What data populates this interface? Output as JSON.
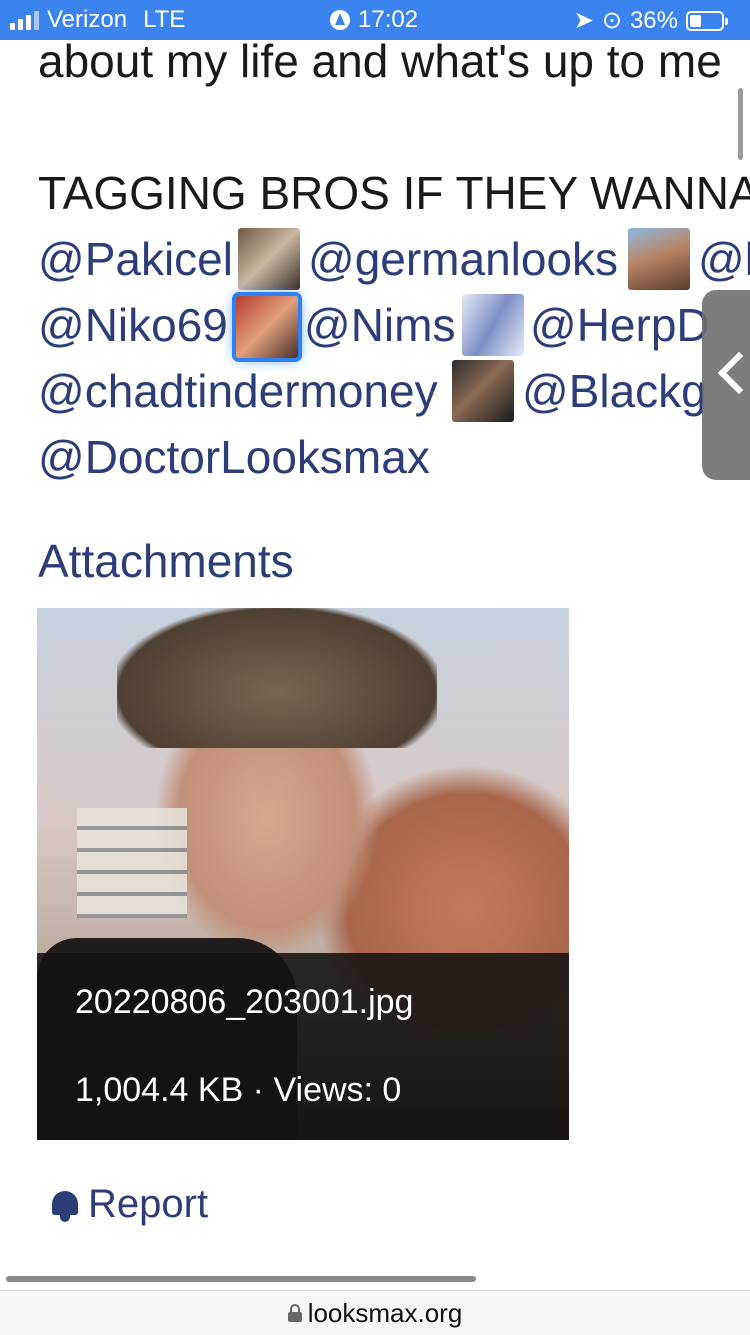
{
  "status_bar": {
    "carrier": "Verizon",
    "network": "LTE",
    "time": "17:02",
    "battery": "36%"
  },
  "post": {
    "line_top": "about my life and what's up to me",
    "line_tag": "TAGGING BROS IF THEY WANNA",
    "mentions": {
      "pakicel": "@Pakicel",
      "germanlooks": "@germanlooks",
      "b": "@b",
      "niko69": "@Niko69",
      "nims": "@Nims",
      "herpd": "@HerpD",
      "chadtindermoney": "@chadtindermoney",
      "blackg": "@Blackg",
      "doctorlooksmax": "@DoctorLooksmax"
    }
  },
  "attachments": {
    "heading": "Attachments",
    "file_name": "20220806_203001.jpg",
    "file_meta": "1,004.4 KB · Views: 0"
  },
  "report_label": "Report",
  "url": "looksmax.org"
}
